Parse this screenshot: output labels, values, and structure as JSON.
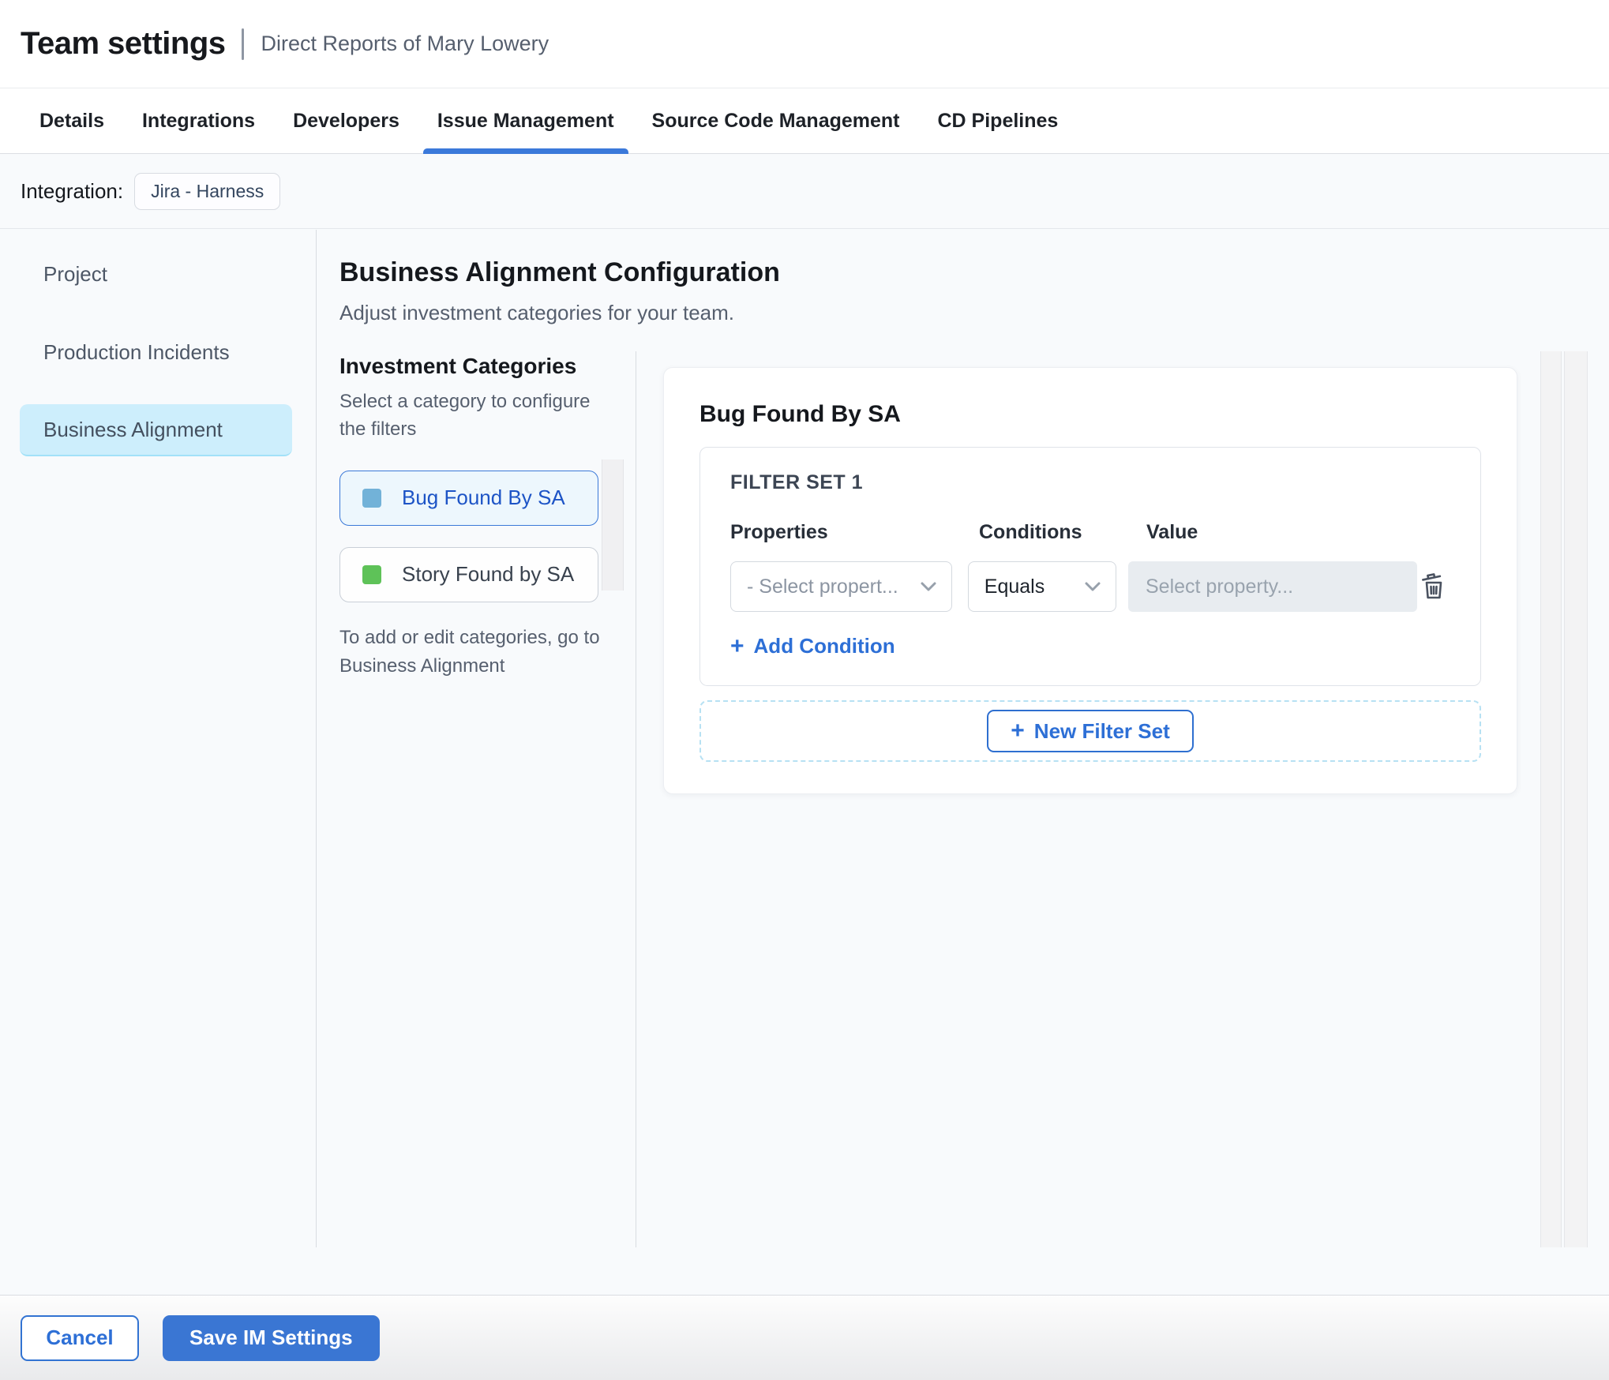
{
  "header": {
    "title": "Team settings",
    "subtitle": "Direct Reports of Mary Lowery"
  },
  "tabs": {
    "items": [
      {
        "label": "Details",
        "active": false
      },
      {
        "label": "Integrations",
        "active": false
      },
      {
        "label": "Developers",
        "active": false
      },
      {
        "label": "Issue Management",
        "active": true
      },
      {
        "label": "Source Code Management",
        "active": false
      },
      {
        "label": "CD Pipelines",
        "active": false
      }
    ]
  },
  "integration_bar": {
    "label": "Integration:",
    "chip": "Jira - Harness"
  },
  "sidebar": {
    "items": [
      {
        "label": "Project",
        "selected": false
      },
      {
        "label": "Production Incidents",
        "selected": false
      },
      {
        "label": "Business Alignment",
        "selected": true
      }
    ]
  },
  "main": {
    "heading": "Business Alignment Configuration",
    "subheading": "Adjust investment categories for your team."
  },
  "categories_panel": {
    "heading": "Investment Categories",
    "description": "Select a category to configure the filters",
    "items": [
      {
        "label": "Bug Found By SA",
        "swatch_color": "#72b2d8",
        "selected": true
      },
      {
        "label": "Story Found by SA",
        "swatch_color": "#5ec258",
        "selected": false
      }
    ],
    "note": "To add or edit categories, go to Business Alignment"
  },
  "filter_panel": {
    "heading": "Bug Found By SA",
    "filter_set": {
      "title": "FILTER SET 1",
      "columns": {
        "properties": "Properties",
        "conditions": "Conditions",
        "value": "Value"
      },
      "row": {
        "properties_value": "- Select propert...",
        "conditions_value": "Equals",
        "value_placeholder": "Select property..."
      },
      "add_condition_label": "Add Condition",
      "plus_glyph": "+"
    },
    "new_filter_set_label": "New Filter Set"
  },
  "footer": {
    "cancel_label": "Cancel",
    "save_label": "Save IM Settings"
  },
  "colors": {
    "accent_blue": "#3a76d3",
    "link_blue": "#2d6fd6",
    "tab_underline": "#3b79da",
    "selected_category_text": "#1d54c6",
    "selected_category_bg": "#edf7fd",
    "sidebar_selected_bg": "#cdeefc",
    "dashed_zone_border": "#b7e1f3",
    "content_bg": "#f8fafc",
    "value_input_bg": "#e8ecf0"
  }
}
